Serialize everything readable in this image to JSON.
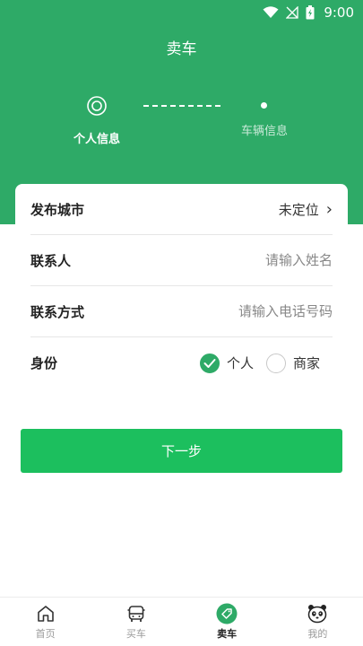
{
  "status": {
    "time": "9:00"
  },
  "header": {
    "title": "卖车"
  },
  "steps": [
    {
      "label": "个人信息",
      "active": true
    },
    {
      "label": "车辆信息",
      "active": false
    }
  ],
  "form": {
    "city": {
      "label": "发布城市",
      "value": "未定位",
      "chevron": "›"
    },
    "contact": {
      "label": "联系人",
      "placeholder": "请输入姓名"
    },
    "phone": {
      "label": "联系方式",
      "placeholder": "请输入电话号码"
    },
    "identity": {
      "label": "身份",
      "options": [
        {
          "label": "个人",
          "checked": true
        },
        {
          "label": "商家",
          "checked": false
        }
      ]
    }
  },
  "next_button": {
    "label": "下一步"
  },
  "tabbar": {
    "items": [
      {
        "label": "首页",
        "icon": "home-icon"
      },
      {
        "label": "买车",
        "icon": "car-front-icon"
      },
      {
        "label": "卖车",
        "icon": "tag-icon",
        "active": true
      },
      {
        "label": "我的",
        "icon": "panda-icon"
      }
    ]
  },
  "colors": {
    "primary": "#2eaa67",
    "button": "#1cbf5e"
  }
}
